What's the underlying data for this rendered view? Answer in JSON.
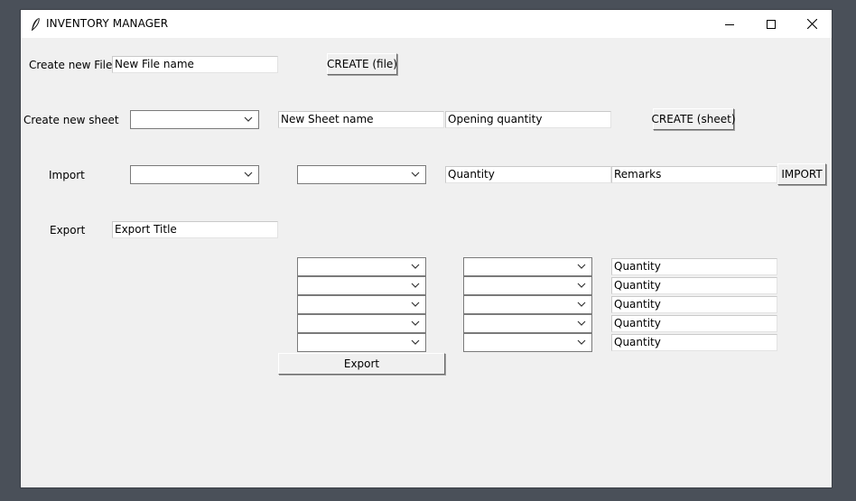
{
  "window": {
    "title": "INVENTORY MANAGER",
    "icon": "feather-icon"
  },
  "create_file": {
    "label": "Create new File",
    "name_value": "New File name",
    "button": "CREATE (file)"
  },
  "create_sheet": {
    "label": "Create new sheet",
    "file_select": "",
    "name_value": "New Sheet name",
    "qty_value": "Opening quantity",
    "button": "CREATE (sheet)"
  },
  "import": {
    "label": "Import",
    "file_select": "",
    "sheet_select": "",
    "qty_value": "Quantity",
    "remarks_value": "Remarks",
    "button": "IMPORT"
  },
  "export": {
    "label": "Export",
    "title_value": "Export Title",
    "rows": [
      {
        "file_select": "",
        "sheet_select": "",
        "qty_value": "Quantity"
      },
      {
        "file_select": "",
        "sheet_select": "",
        "qty_value": "Quantity"
      },
      {
        "file_select": "",
        "sheet_select": "",
        "qty_value": "Quantity"
      },
      {
        "file_select": "",
        "sheet_select": "",
        "qty_value": "Quantity"
      },
      {
        "file_select": "",
        "sheet_select": "",
        "qty_value": "Quantity"
      }
    ],
    "button": "Export"
  }
}
